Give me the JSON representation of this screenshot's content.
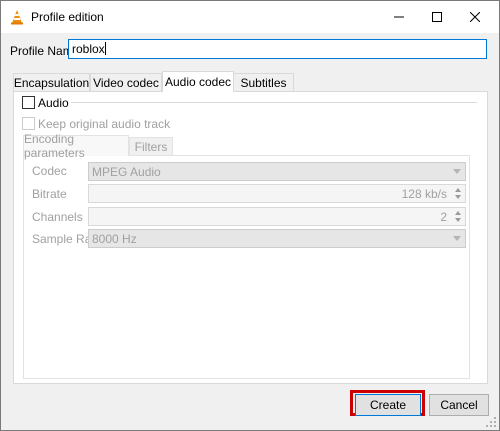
{
  "window": {
    "title": "Profile edition",
    "icon": "vlc-cone-icon"
  },
  "profile": {
    "label": "Profile Name",
    "value": "roblox"
  },
  "tabs": [
    {
      "label": "Encapsulation",
      "active": false
    },
    {
      "label": "Video codec",
      "active": false
    },
    {
      "label": "Audio codec",
      "active": true
    },
    {
      "label": "Subtitles",
      "active": false
    }
  ],
  "audio": {
    "enable_label": "Audio",
    "enabled": false,
    "keep_original_label": "Keep original audio track",
    "keep_original_checked": false
  },
  "subtabs": [
    {
      "label": "Encoding parameters",
      "active": true
    },
    {
      "label": "Filters",
      "active": false
    }
  ],
  "encoding": {
    "codec_label": "Codec",
    "codec_value": "MPEG Audio",
    "bitrate_label": "Bitrate",
    "bitrate_value": "128 kb/s",
    "channels_label": "Channels",
    "channels_value": "2",
    "sample_rate_label": "Sample Rate",
    "sample_rate_value": "8000 Hz"
  },
  "buttons": {
    "create": "Create",
    "cancel": "Cancel"
  },
  "colors": {
    "highlight": "#cc0000",
    "focus_border": "#0078d7"
  }
}
